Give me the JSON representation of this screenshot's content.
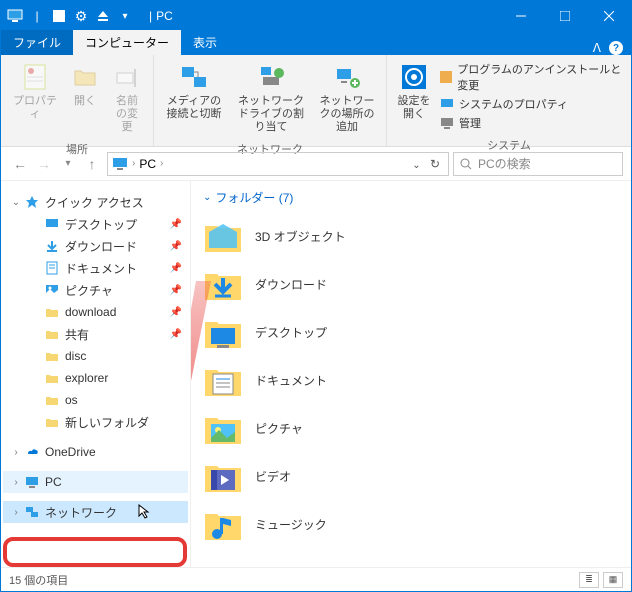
{
  "titlebar": {
    "title_sep": "|",
    "title": "PC"
  },
  "tabs": {
    "file": "ファイル",
    "computer": "コンピューター",
    "view": "表示"
  },
  "ribbon": {
    "group1_label": "場所",
    "properties": "プロパティ",
    "open": "開く",
    "rename": "名前の変更",
    "group2_label": "ネットワーク",
    "media": "メディアの接続と切断",
    "map_drive": "ネットワーク ドライブの割り当て",
    "add_net": "ネットワークの場所の追加",
    "group3_label": "システム",
    "settings": "設定を開く",
    "uninstall": "プログラムのアンインストールと変更",
    "sys_properties": "システムのプロパティ",
    "manage": "管理"
  },
  "nav": {
    "crumb": "PC",
    "search_icon_label": "search",
    "search_placeholder": "PCの検索"
  },
  "sidebar": {
    "quick_access": "クイック アクセス",
    "items": [
      {
        "label": "デスクトップ",
        "pinned": true
      },
      {
        "label": "ダウンロード",
        "pinned": true
      },
      {
        "label": "ドキュメント",
        "pinned": true
      },
      {
        "label": "ピクチャ",
        "pinned": true
      },
      {
        "label": "download",
        "pinned": true
      },
      {
        "label": "共有",
        "pinned": true
      },
      {
        "label": "disc",
        "pinned": false
      },
      {
        "label": "explorer",
        "pinned": false
      },
      {
        "label": "os",
        "pinned": false
      },
      {
        "label": "新しいフォルダ",
        "pinned": false
      }
    ],
    "onedrive": "OneDrive",
    "pc": "PC",
    "network": "ネットワーク"
  },
  "content": {
    "group_header": "フォルダー (7)",
    "folders": [
      "3D オブジェクト",
      "ダウンロード",
      "デスクトップ",
      "ドキュメント",
      "ピクチャ",
      "ビデオ",
      "ミュージック"
    ]
  },
  "statusbar": {
    "count": "15 個の項目"
  }
}
